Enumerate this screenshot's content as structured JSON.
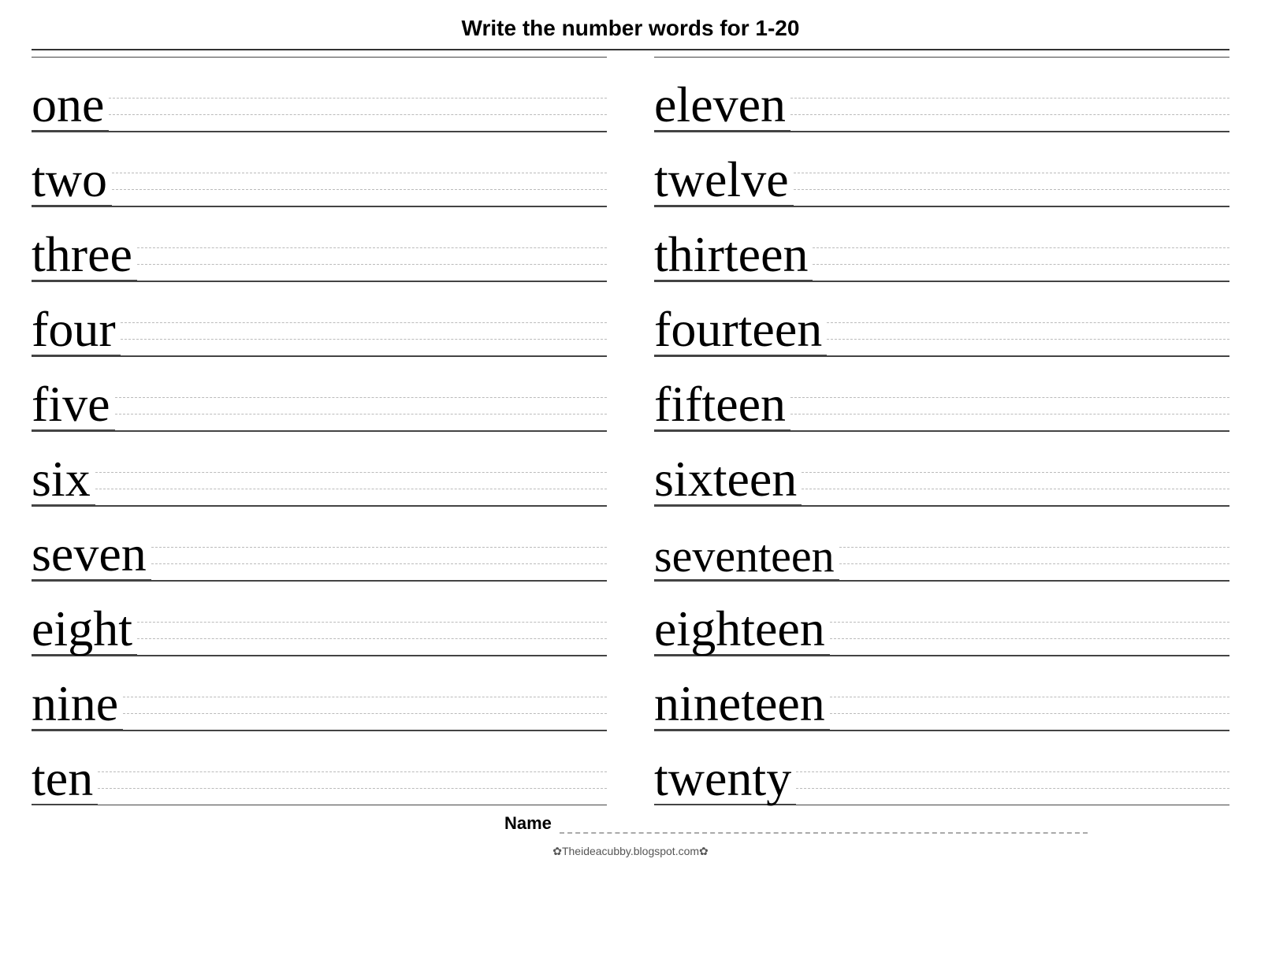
{
  "title": "Write the number words for  1-20",
  "columns": {
    "left": [
      {
        "word": "one"
      },
      {
        "word": "two"
      },
      {
        "word": "three"
      },
      {
        "word": "four"
      },
      {
        "word": "five"
      },
      {
        "word": "six"
      },
      {
        "word": "seven"
      },
      {
        "word": "eight"
      },
      {
        "word": "nine"
      },
      {
        "word": "ten"
      }
    ],
    "right": [
      {
        "word": "eleven"
      },
      {
        "word": "twelve"
      },
      {
        "word": "thirteen"
      },
      {
        "word": "fourteen"
      },
      {
        "word": "fifteen"
      },
      {
        "word": "sixteen"
      },
      {
        "word": "seventeen"
      },
      {
        "word": "eighteen"
      },
      {
        "word": "nineteen"
      },
      {
        "word": "twenty"
      }
    ]
  },
  "name_label": "Name",
  "footer": "✿Theideacubby.blogspot.com✿"
}
